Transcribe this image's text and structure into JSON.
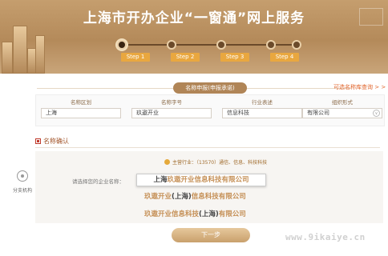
{
  "header": {
    "title": "上海市开办企业“一窗通”网上服务",
    "steps": [
      "Step 1",
      "Step 2",
      "Step 3",
      "Step 4"
    ]
  },
  "name_section": {
    "pill": "名称申报(申报承诺)",
    "optional_link": "可选名称库查询 > >"
  },
  "form": {
    "fields": [
      {
        "label": "名称区划",
        "value": "上海"
      },
      {
        "label": "名称字号",
        "value": "玖遨开业"
      },
      {
        "label": "行业表述",
        "value": "信息科技"
      },
      {
        "label": "组织形式",
        "value": "有限公司"
      }
    ]
  },
  "confirm": {
    "label": "名称确认",
    "industry": "主营行业：（13570）通信、信息、科技科技",
    "choose_label": "请选择您的企业名称：",
    "options": [
      {
        "pre": "上海",
        "mid": "玖遨开业信息科技有限公司",
        "post": ""
      },
      {
        "pre": "玖遨开业",
        "mid": "(上海)",
        "post": "信息科技有限公司"
      },
      {
        "pre": "玖遨开业信息科技",
        "mid": "(上海)",
        "post": "有限公司"
      }
    ]
  },
  "sidenav": {
    "label": "分支机构",
    "icon": "target-icon"
  },
  "next_button": "下一步",
  "watermark": "www.9ikaiye.cn",
  "colors": {
    "accent": "#b08557",
    "step_badge": "#e9a73f",
    "link": "#e0652c"
  }
}
